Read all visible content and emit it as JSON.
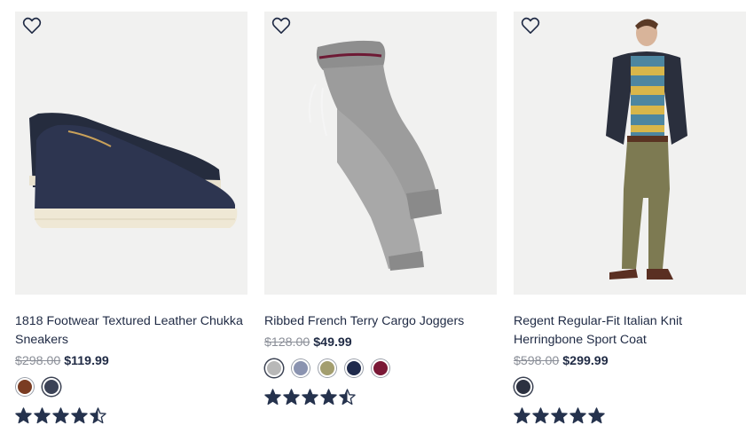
{
  "products": [
    {
      "name": "1818 Footwear Textured Leather Chukka Sneakers",
      "original_price": "$298.00",
      "sale_price": "$119.99",
      "rating": 4.5,
      "swatches": [
        {
          "color": "#7a3c22",
          "label": "brown",
          "pattern": "textured"
        },
        {
          "color": "#3b4256",
          "label": "navy",
          "pattern": "textured"
        }
      ]
    },
    {
      "name": "Ribbed French Terry Cargo Joggers",
      "original_price": "$128.00",
      "sale_price": "$49.99",
      "rating": 4.5,
      "swatches": [
        {
          "color": "#b8b8b8",
          "label": "grey"
        },
        {
          "color": "#8a93b0",
          "label": "light-blue"
        },
        {
          "color": "#a39e6f",
          "label": "olive"
        },
        {
          "color": "#1f2a4c",
          "label": "navy"
        },
        {
          "color": "#7a1836",
          "label": "burgundy"
        }
      ]
    },
    {
      "name": "Regent Regular-Fit Italian Knit Herringbone Sport Coat",
      "original_price": "$598.00",
      "sale_price": "$299.99",
      "rating": 5,
      "swatches": [
        {
          "color": "#2c3140",
          "label": "charcoal"
        }
      ]
    }
  ],
  "icons": {
    "wishlist": "heart-outline-icon",
    "rating": "star-icon"
  },
  "colors": {
    "text": "#1f2a44",
    "strike": "#8b8f98",
    "star": "#25324d",
    "image_bg": "#f1f1f0"
  }
}
